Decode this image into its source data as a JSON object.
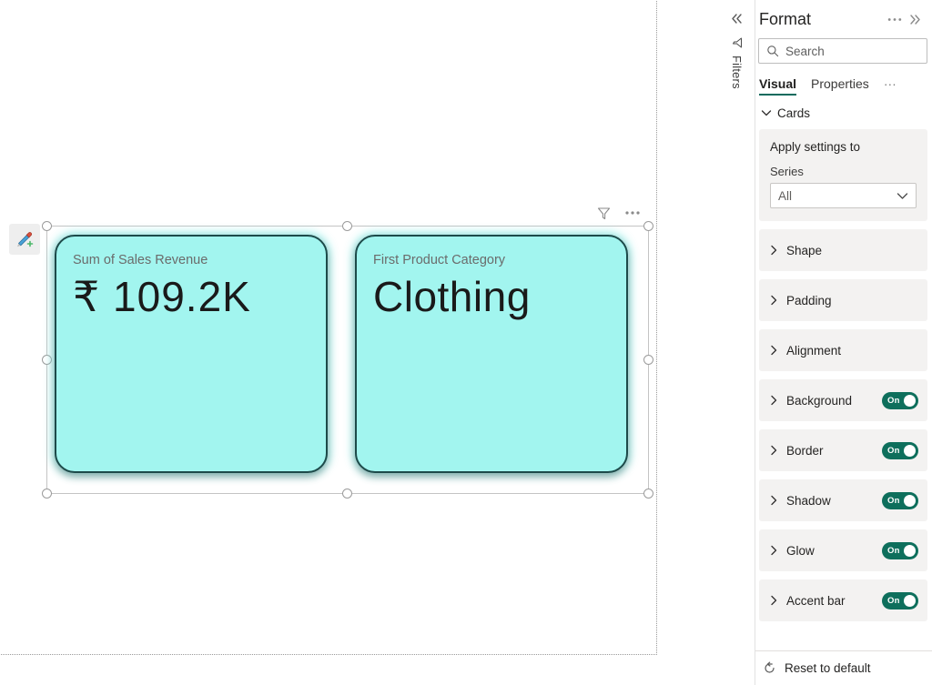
{
  "canvas": {
    "format_painter_icon": "paint-brush-plus-icon",
    "visual_header": {
      "filter_icon": "funnel-icon",
      "more_options_icon": "more-options-icon"
    },
    "cards": [
      {
        "label": "Sum of Sales Revenue",
        "value": "₹ 109.2K",
        "fill_color": "#a2f5ef",
        "border_color": "#1d4a4a"
      },
      {
        "label": "First Product Category",
        "value": "Clothing",
        "fill_color": "#a2f5ef",
        "border_color": "#1d4a4a"
      }
    ]
  },
  "filters_rail": {
    "collapse_icon": "chevron-double-left-icon",
    "funnel_icon": "funnel-icon",
    "label": "Filters"
  },
  "format_pane": {
    "title": "Format",
    "more_icon": "more-options-icon",
    "expand_icon": "chevron-double-right-icon",
    "search": {
      "icon": "search-icon",
      "placeholder": "Search",
      "value": ""
    },
    "tabs": [
      {
        "label": "Visual",
        "active": true
      },
      {
        "label": "Properties",
        "active": false
      }
    ],
    "tabs_more": "···",
    "section": {
      "chevron_icon": "chevron-down-icon",
      "label": "Cards"
    },
    "apply_settings": {
      "title": "Apply settings to",
      "field_label": "Series",
      "selected_value": "All",
      "chevron_icon": "chevron-down-icon"
    },
    "accordions": [
      {
        "label": "Shape",
        "chevron_icon": "chevron-right-icon",
        "has_toggle": false,
        "toggle_state": ""
      },
      {
        "label": "Padding",
        "chevron_icon": "chevron-right-icon",
        "has_toggle": false,
        "toggle_state": ""
      },
      {
        "label": "Alignment",
        "chevron_icon": "chevron-right-icon",
        "has_toggle": false,
        "toggle_state": ""
      },
      {
        "label": "Background",
        "chevron_icon": "chevron-right-icon",
        "has_toggle": true,
        "toggle_state": "On"
      },
      {
        "label": "Border",
        "chevron_icon": "chevron-right-icon",
        "has_toggle": true,
        "toggle_state": "On"
      },
      {
        "label": "Shadow",
        "chevron_icon": "chevron-right-icon",
        "has_toggle": true,
        "toggle_state": "On"
      },
      {
        "label": "Glow",
        "chevron_icon": "chevron-right-icon",
        "has_toggle": true,
        "toggle_state": "On"
      },
      {
        "label": "Accent bar",
        "chevron_icon": "chevron-right-icon",
        "has_toggle": true,
        "toggle_state": "On"
      }
    ],
    "footer": {
      "icon": "reset-arrow-icon",
      "label": "Reset to default"
    },
    "accent_color": "#0b6a5d",
    "toggle_on_color": "#0e6f5c"
  }
}
